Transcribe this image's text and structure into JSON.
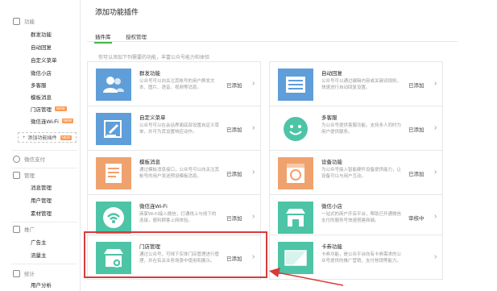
{
  "sidebar": {
    "section_function": "功能",
    "function_items": [
      {
        "label": "群发功能"
      },
      {
        "label": "自动回复"
      },
      {
        "label": "自定义菜单"
      },
      {
        "label": "微信小店"
      },
      {
        "label": "多客服"
      },
      {
        "label": "模板消息"
      },
      {
        "label": "门店管理",
        "badge": "NEW"
      },
      {
        "label": "微信连Wi-Fi",
        "badge": "NEW"
      }
    ],
    "add_plugin_label": "添加功能插件",
    "add_plugin_badge": "NEW",
    "section_pay": "微信支付",
    "section_manage": "管理",
    "manage_items": [
      {
        "label": "消息管理"
      },
      {
        "label": "用户管理"
      },
      {
        "label": "素材管理"
      }
    ],
    "section_promo": "推广",
    "promo_items": [
      {
        "label": "广告主"
      },
      {
        "label": "流量主"
      }
    ],
    "section_stats": "统计",
    "stats_items": [
      {
        "label": "用户分析"
      }
    ]
  },
  "main": {
    "title": "添加功能插件",
    "tabs": [
      {
        "label": "插件库",
        "active": true
      },
      {
        "label": "授权管理",
        "active": false
      }
    ],
    "intro": "你可以添加下列需要的功能，丰富公众号能力和体验"
  },
  "plugins": [
    {
      "name": "群发功能",
      "desc": "公众号可以向关注其帐号的用户群发文本、图片、语音、视频等消息。",
      "status": "已添加",
      "color": "#5f9ed8",
      "icon": "user-group-icon"
    },
    {
      "name": "自动回复",
      "desc": "公众号可以通过编辑内容或关键词规则，快速进行自动回复设置。",
      "status": "已添加",
      "color": "#5f9ed8",
      "icon": "list-reply-icon"
    },
    {
      "name": "自定义菜单",
      "desc": "公众号可以在会话界面底部设置自定义菜单，并可为其设置响应动作。",
      "status": "已添加",
      "color": "#5f9ed8",
      "icon": "edit-pen-icon"
    },
    {
      "name": "多客服",
      "desc": "为公众号提供客服功能，支持多人同时为用户提供服务。",
      "status": "已添加",
      "color": "#4dc4a6",
      "icon": "smile-face-icon"
    },
    {
      "name": "模板消息",
      "desc": "通过模板消息接口，公众号可以向关注其帐号的用户发送预设模板消息。",
      "status": "已添加",
      "color": "#f0a26e",
      "icon": "template-doc-icon"
    },
    {
      "name": "设备功能",
      "desc": "为公众号接入智能硬件设备提供能力，让设备可以与用户互动。",
      "status": "已添加",
      "color": "#f0a26e",
      "icon": "device-icon"
    },
    {
      "name": "微信连Wi-Fi",
      "desc": "商家Wi-Fi接入微信，打通线上与线下的连接，便利顾客上网体验。",
      "status": "已添加",
      "color": "#4dc4a6",
      "icon": "wifi-icon"
    },
    {
      "name": "微信小店",
      "desc": "一站式的商户开店平台，帮助已开通微信支付的服务号快速搭建商城。",
      "status": "审核中",
      "color": "#4dc4a6",
      "icon": "shop-icon"
    },
    {
      "name": "门店管理",
      "desc": "通过公众号，可线下实体门店管理进行管理，并在有关业务场景中使用和展示。",
      "status": "已添加",
      "color": "#4dc4a6",
      "icon": "store-icon"
    },
    {
      "name": "卡券功能",
      "desc": "卡券功能，是公众平台向有卡券需求的公众号提供的推广营销、支付核销等能力。",
      "status": "",
      "color": "#4dc4a6",
      "icon": "card-coupon-icon"
    }
  ]
}
